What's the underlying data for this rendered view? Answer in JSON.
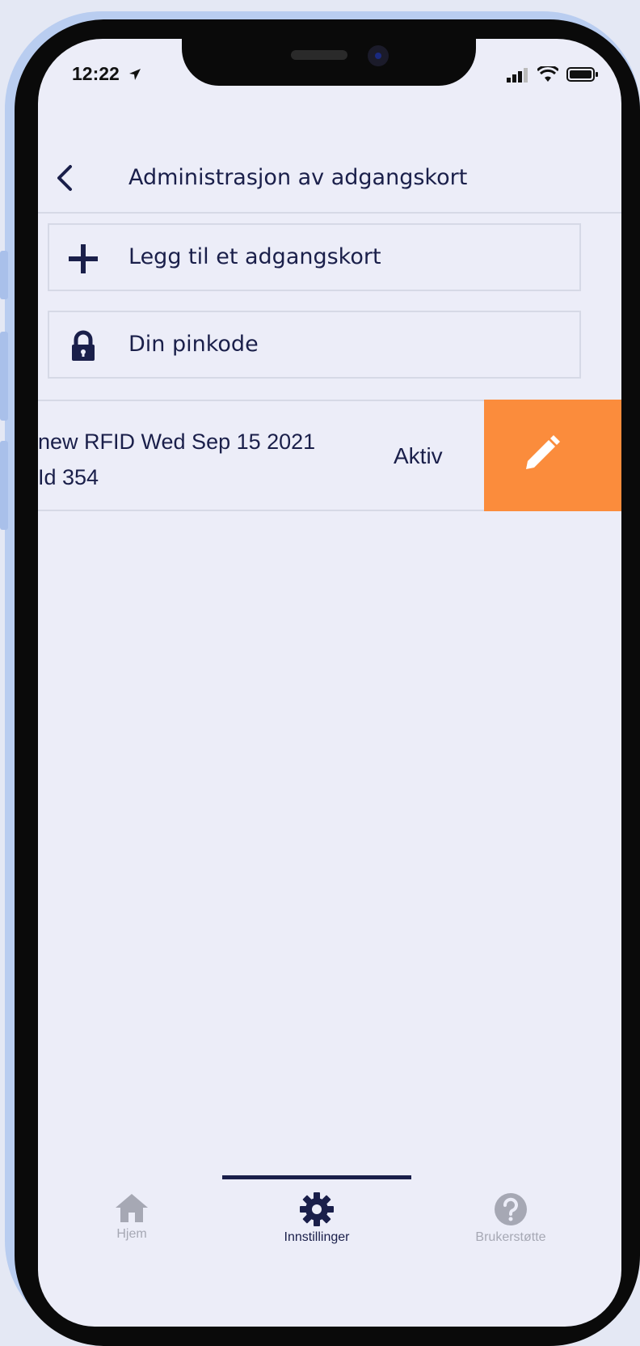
{
  "status_bar": {
    "time": "12:22"
  },
  "header": {
    "title": "Administrasjon av adgangskort"
  },
  "actions": [
    {
      "label": "Legg til et adgangskort",
      "icon": "plus-icon"
    },
    {
      "label": "Din pinkode",
      "icon": "lock-icon"
    }
  ],
  "cards": [
    {
      "name_line1": "new RFID Wed Sep 15 2021",
      "name_line2": "Id 354",
      "status": "Aktiv",
      "edit_icon": "pencil-icon"
    }
  ],
  "tabs": [
    {
      "label": "Hjem",
      "icon": "home-icon",
      "active": false
    },
    {
      "label": "Innstillinger",
      "icon": "gear-icon",
      "active": true
    },
    {
      "label": "Brukerstøtte",
      "icon": "help-icon",
      "active": false
    }
  ],
  "colors": {
    "accent": "#fb8c3c",
    "text": "#1a1f4a",
    "background": "#ecedf8",
    "inactive": "#a6a8b4"
  }
}
